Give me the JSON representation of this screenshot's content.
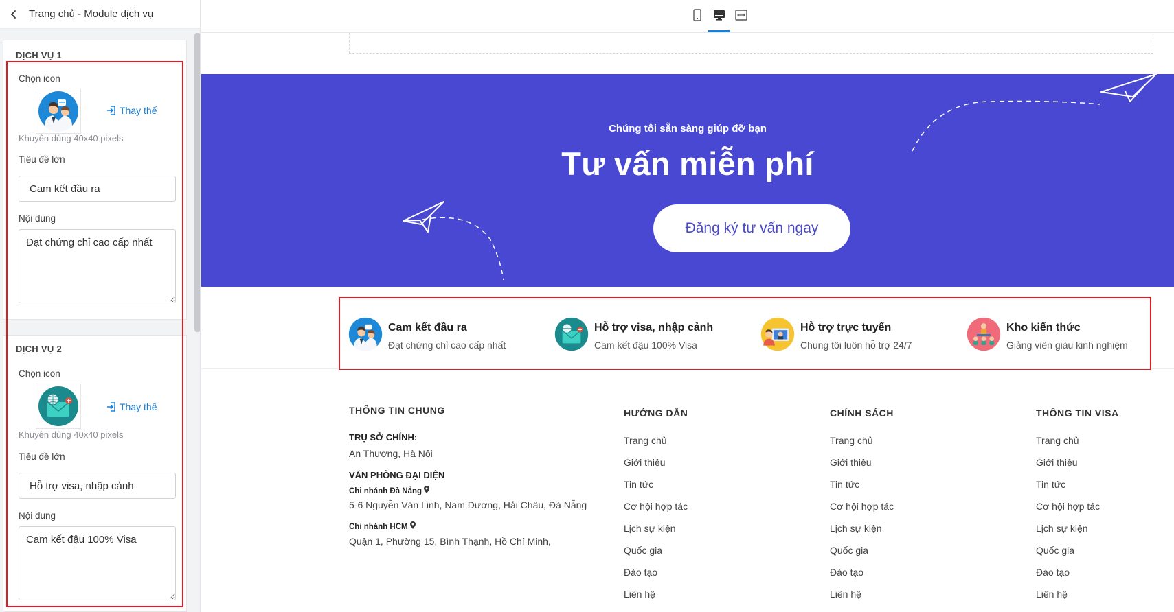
{
  "sidebar": {
    "title": "Trang chủ - Module dịch vụ",
    "services": [
      {
        "heading": "DỊCH VỤ 1",
        "icon_label": "Chọn icon",
        "icon": "consultant-icon",
        "replace_label": "Thay thế",
        "hint": "Khuyên dùng 40x40 pixels",
        "title_label": "Tiêu đề lớn",
        "title_value": "Cam kết đầu ra",
        "content_label": "Nội dung",
        "content_value": "Đạt chứng chỉ cao cấp nhất"
      },
      {
        "heading": "DỊCH VỤ 2",
        "icon_label": "Chọn icon",
        "icon": "visa-mail-icon",
        "replace_label": "Thay thế",
        "hint": "Khuyên dùng 40x40 pixels",
        "title_label": "Tiêu đề lớn",
        "title_value": "Hỗ trợ visa, nhập cảnh",
        "content_label": "Nội dung",
        "content_value": "Cam kết đậu 100% Visa"
      }
    ]
  },
  "topbar": {
    "devices": [
      "mobile-icon",
      "desktop-icon",
      "fullwidth-icon"
    ],
    "active_device": "desktop-icon"
  },
  "hero": {
    "subtitle": "Chúng tôi sẵn sàng giúp đỡ bạn",
    "title": "Tư vấn miễn phí",
    "button": "Đăng ký tư vấn ngay",
    "background": "#4848d2"
  },
  "services": [
    {
      "icon": "consultant-icon",
      "title": "Cam kết đầu ra",
      "desc": "Đạt chứng chỉ cao cấp nhất"
    },
    {
      "icon": "visa-mail-icon",
      "title": "Hỗ trợ visa, nhập cảnh",
      "desc": "Cam kết đậu 100% Visa"
    },
    {
      "icon": "online-support-icon",
      "title": "Hỗ trợ trực tuyến",
      "desc": "Chúng tôi luôn hỗ trợ 24/7"
    },
    {
      "icon": "knowledge-icon",
      "title": "Kho kiến thức",
      "desc": "Giảng viên giàu kinh nghiệm"
    }
  ],
  "footer": {
    "info": {
      "heading": "THÔNG TIN CHUNG",
      "hq_label": "TRỤ SỞ CHÍNH:",
      "hq_address": "An Thượng, Hà Nội",
      "rep_label": "VĂN PHÒNG ĐẠI DIỆN",
      "branch1_label": "Chi nhánh Đà Nẵng",
      "branch1_address": "5-6 Nguyễn Văn Linh, Nam Dương, Hải Châu, Đà Nẵng",
      "branch2_label": "Chi nhánh HCM",
      "branch2_address": "Quận 1, Phường 15, Bình Thạnh, Hồ Chí Minh,"
    },
    "columns": [
      {
        "heading": "HƯỚNG DẪN",
        "links": [
          "Trang chủ",
          "Giới thiệu",
          "Tin tức",
          "Cơ hội hợp tác",
          "Lịch sự kiện",
          "Quốc gia",
          "Đào tạo",
          "Liên hệ"
        ]
      },
      {
        "heading": "CHÍNH SÁCH",
        "links": [
          "Trang chủ",
          "Giới thiệu",
          "Tin tức",
          "Cơ hội hợp tác",
          "Lịch sự kiện",
          "Quốc gia",
          "Đào tạo",
          "Liên hệ"
        ]
      },
      {
        "heading": "THÔNG TIN VISA",
        "links": [
          "Trang chủ",
          "Giới thiệu",
          "Tin tức",
          "Cơ hội hợp tác",
          "Lịch sự kiện",
          "Quốc gia",
          "Đào tạo",
          "Liên hệ"
        ]
      }
    ]
  },
  "colors": {
    "accent": "#1a7fd4",
    "highlight_box": "#e01b24",
    "hero": "#4848d2"
  }
}
